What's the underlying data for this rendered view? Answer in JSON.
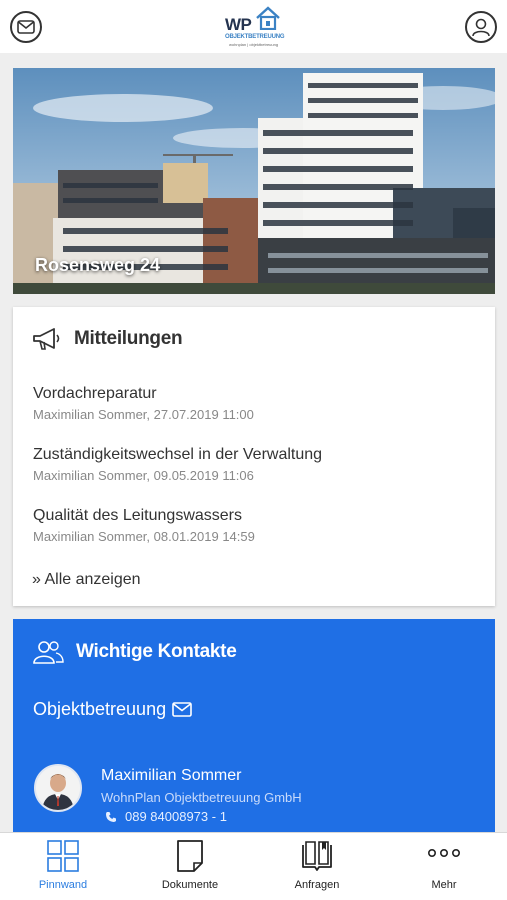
{
  "header": {
    "logo_text": "WP",
    "logo_line": "OBJEKTBETREUUNG",
    "logo_sub": "wohnplan | objektbetreuung"
  },
  "hero": {
    "address": "Rosensweg 24"
  },
  "messages": {
    "title": "Mitteilungen",
    "items": [
      {
        "title": "Vordachreparatur",
        "meta": "Maximilian Sommer, 27.07.2019 11:00"
      },
      {
        "title": "Zuständigkeitswechsel in der Verwaltung",
        "meta": "Maximilian Sommer, 09.05.2019 11:06"
      },
      {
        "title": "Qualität des Leitungswassers",
        "meta": "Maximilian Sommer, 08.01.2019 14:59"
      }
    ],
    "show_all": "» Alle anzeigen"
  },
  "contacts": {
    "title": "Wichtige Kontakte",
    "section_label": "Objektbetreuung",
    "person": {
      "name": "Maximilian Sommer",
      "company": "WohnPlan Objektbetreuung GmbH",
      "phone": "089 84008973 - 1"
    }
  },
  "tabs": [
    {
      "label": "Pinnwand",
      "icon": "grid-icon",
      "active": true
    },
    {
      "label": "Dokumente",
      "icon": "document-icon",
      "active": false
    },
    {
      "label": "Anfragen",
      "icon": "book-icon",
      "active": false
    },
    {
      "label": "Mehr",
      "icon": "more-icon",
      "active": false
    }
  ],
  "colors": {
    "accent": "#1f6fe5",
    "tab_active": "#2b7de0",
    "background": "#eeeeee"
  }
}
